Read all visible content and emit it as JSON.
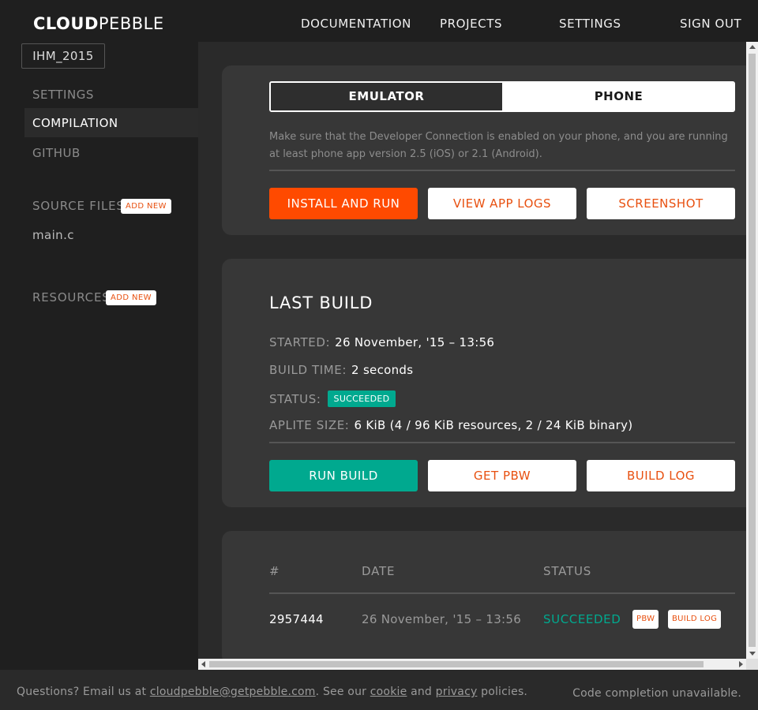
{
  "header": {
    "logo_bold": "CLOUD",
    "logo_light": "PEBBLE",
    "nav": {
      "documentation": "DOCUMENTATION",
      "projects": "PROJECTS",
      "settings": "SETTINGS",
      "sign_out": "SIGN OUT"
    }
  },
  "sidebar": {
    "project_name": "IHM_2015",
    "links": {
      "settings": "SETTINGS",
      "compilation": "COMPILATION",
      "github": "GITHUB"
    },
    "source_files": {
      "title": "SOURCE FILES",
      "add_new": "ADD NEW",
      "files": [
        "main.c"
      ]
    },
    "resources": {
      "title": "RESOURCES",
      "add_new": "ADD NEW"
    }
  },
  "target": {
    "emulator_label": "EMULATOR",
    "phone_label": "PHONE",
    "selected": "EMULATOR",
    "hint": "Make sure that the Developer Connection is enabled on your phone, and you are running at least phone app version 2.5 (iOS) or 2.1 (Android).",
    "buttons": {
      "install_run": "INSTALL AND RUN",
      "view_logs": "VIEW APP LOGS",
      "screenshot": "SCREENSHOT"
    }
  },
  "last_build": {
    "title": "LAST BUILD",
    "started_label": "STARTED:",
    "started_value": "26 November, '15 – 13:56",
    "build_time_label": "BUILD TIME:",
    "build_time_value": "2 seconds",
    "status_label": "STATUS:",
    "status_value": "SUCCEEDED",
    "size_label": "APLITE SIZE:",
    "size_value": "6 KiB (4 / 96 KiB resources, 2 / 24 KiB binary)",
    "buttons": {
      "run_build": "RUN BUILD",
      "get_pbw": "GET PBW",
      "build_log": "BUILD LOG"
    }
  },
  "history": {
    "columns": [
      "#",
      "DATE",
      "STATUS"
    ],
    "rows": [
      {
        "id": "2957444",
        "date": "26 November, '15 – 13:56",
        "status": "SUCCEEDED",
        "pbw_label": "PBW",
        "log_label": "BUILD LOG"
      }
    ]
  },
  "footer": {
    "text_prefix": "Questions? Email us at",
    "email": "cloudpebble@getpebble.com",
    "text_mid": ". See our",
    "cookie": "cookie",
    "and": "and",
    "privacy": "privacy",
    "policies": "policies.",
    "right": "Code completion unavailable."
  },
  "colors": {
    "accent_orange": "#ff4a00",
    "accent_teal": "#00a98f",
    "link_orange": "#e85010"
  }
}
